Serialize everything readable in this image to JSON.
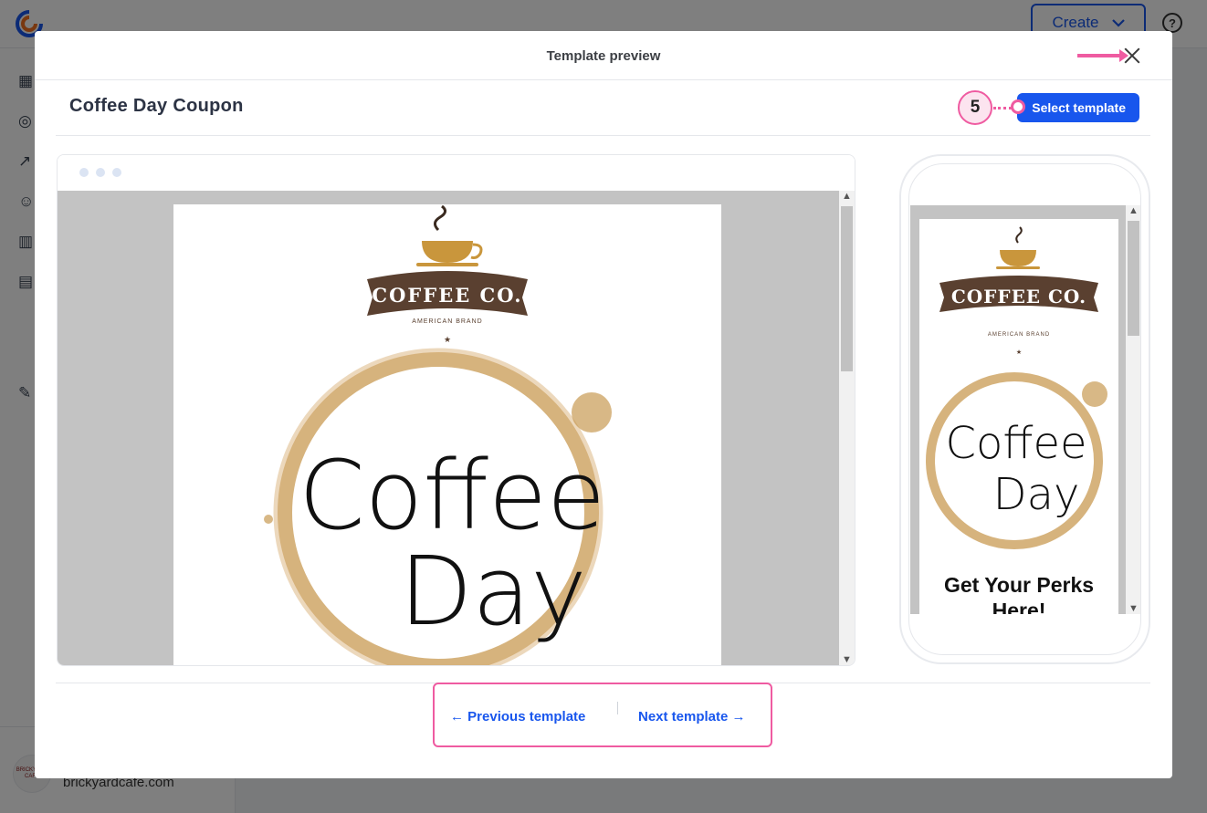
{
  "app": {
    "create_label": "Create",
    "help_label": "?",
    "account_name": "brickyardcafe.com",
    "account_logo_text": "BRICKYARD CAFE"
  },
  "modal": {
    "title": "Template preview",
    "template_name": "Coffee Day Coupon",
    "select_button": "Select template",
    "step_number": "5",
    "prev_label": "Previous template",
    "next_label": "Next template",
    "prev_arrow": "←",
    "next_arrow": "→"
  },
  "email": {
    "brand_name": "COFFEE CO.",
    "brand_sub": "AMERICAN BRAND",
    "headline_1": "Coffee",
    "headline_2": "Day",
    "perks": "Get Your Perks Here!"
  },
  "colors": {
    "accent": "#1856ed",
    "callout": "#ef5ba1",
    "brand_brown": "#5a4030",
    "cup_gold": "#c9963c",
    "stain": "#c89a52"
  },
  "icons": [
    "logo-icon",
    "chevron-down-icon",
    "help-icon",
    "close-icon",
    "arrow-left-icon",
    "arrow-right-icon",
    "scroll-up-icon",
    "scroll-down-icon"
  ]
}
